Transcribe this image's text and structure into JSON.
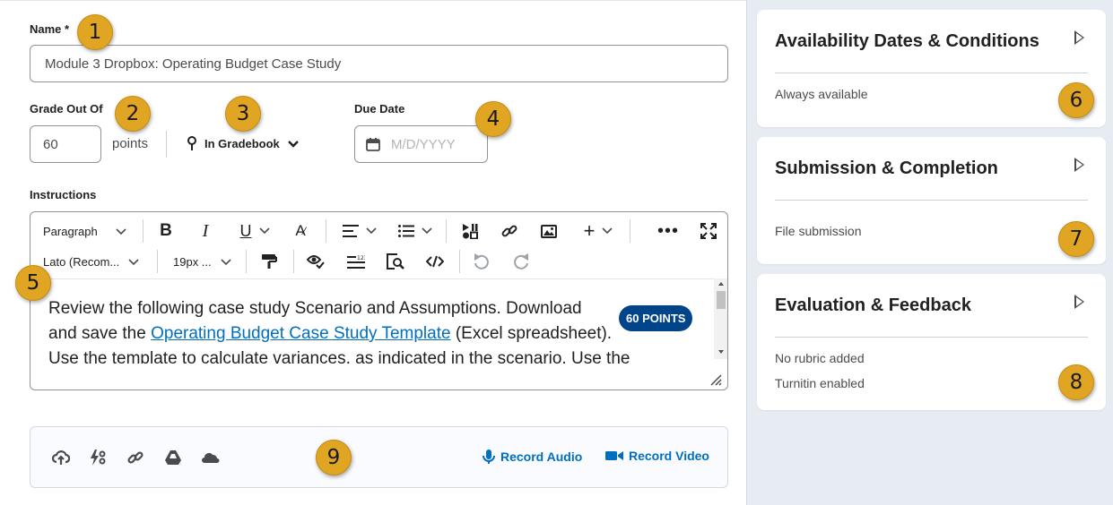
{
  "form": {
    "name_label": "Name *",
    "name_value": "Module 3 Dropbox: Operating Budget Case Study",
    "grade_label": "Grade Out Of",
    "grade_value": "60",
    "points_label": "points",
    "gradebook_label": "In Gradebook",
    "due_label": "Due Date",
    "due_placeholder": "M/D/YYYY",
    "instructions_label": "Instructions"
  },
  "toolbar": {
    "paragraph": "Paragraph",
    "font": "Lato (Recom...",
    "size": "19px ...",
    "icons": [
      "bold-icon",
      "italic-icon",
      "underline-icon",
      "format-icon",
      "align-icon",
      "list-icon",
      "insert-stuff-icon",
      "link-icon",
      "image-icon",
      "plus-icon",
      "more-icon",
      "fullscreen-icon",
      "format-painter-icon",
      "accessibility-icon",
      "word-count-icon",
      "find-replace-icon",
      "source-code-icon",
      "undo-icon",
      "redo-icon"
    ]
  },
  "editor": {
    "text_1": "Review the following case study Scenario and Assumptions. Download",
    "text_2a": "and save the ",
    "link": "Operating Budget Case Study Template",
    "text_2b": " (Excel spreadsheet).",
    "text_3": "Use the template to calculate variances, as indicated in the scenario. Use the",
    "pill": "60 POINTS"
  },
  "attachments": {
    "icons": [
      "upload-icon",
      "lightning-icon",
      "link-icon",
      "google-drive-icon",
      "onedrive-icon"
    ],
    "record_audio": "Record Audio",
    "record_video": "Record Video"
  },
  "side": {
    "cards": [
      {
        "title": "Availability Dates & Conditions",
        "lines": [
          "Always available"
        ]
      },
      {
        "title": "Submission & Completion",
        "lines": [
          "File submission"
        ]
      },
      {
        "title": "Evaluation & Feedback",
        "lines": [
          "No rubric added",
          "Turnitin enabled"
        ]
      }
    ]
  },
  "badges": [
    "1",
    "2",
    "3",
    "4",
    "5",
    "6",
    "7",
    "8",
    "9"
  ],
  "colors": {
    "accent": "#006fbf",
    "badge": "#e0a522",
    "pill": "#004489",
    "side_bg": "#e7ecf3"
  }
}
